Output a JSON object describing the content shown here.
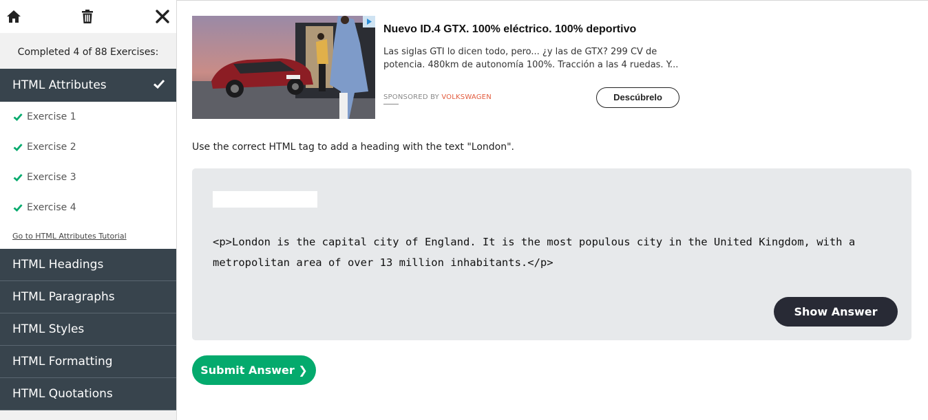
{
  "sidebar": {
    "completed_text": "Completed 4 of 88 Exercises:",
    "active_section": {
      "label": "HTML Attributes",
      "exercises": [
        {
          "label": "Exercise 1"
        },
        {
          "label": "Exercise 2"
        },
        {
          "label": "Exercise 3"
        },
        {
          "label": "Exercise 4"
        }
      ],
      "tutorial_link": "Go to HTML Attributes Tutorial"
    },
    "sections": [
      {
        "label": "HTML Headings"
      },
      {
        "label": "HTML Paragraphs"
      },
      {
        "label": "HTML Styles"
      },
      {
        "label": "HTML Formatting"
      },
      {
        "label": "HTML Quotations"
      }
    ]
  },
  "ad": {
    "title": "Nuevo ID.4 GTX. 100% eléctrico. 100% deportivo",
    "description": "Las siglas GTI lo dicen todo, pero... ¿y las de GTX? 299 CV de potencia. 480km de autonomía 100%. Tracción a las 4 ruedas. Y...",
    "sponsored_by": "SPONSORED BY",
    "brand": "VOLKSWAGEN",
    "cta": "Descúbrelo"
  },
  "exercise": {
    "instruction": "Use the correct HTML tag to add a heading with the text \"London\".",
    "input_value": "",
    "code": "<p>London is the capital city of England. It is the most populous city in the United Kingdom, with a metropolitan area of over 13 million inhabitants.</p>",
    "show_answer_label": "Show Answer",
    "submit_label": "Submit Answer ❯"
  },
  "colors": {
    "sidebar_dark": "#38444d",
    "check_green": "#04aa6d",
    "submit_green": "#04aa6d",
    "show_answer_bg": "#282a35",
    "code_bg": "#e7e9eb"
  }
}
